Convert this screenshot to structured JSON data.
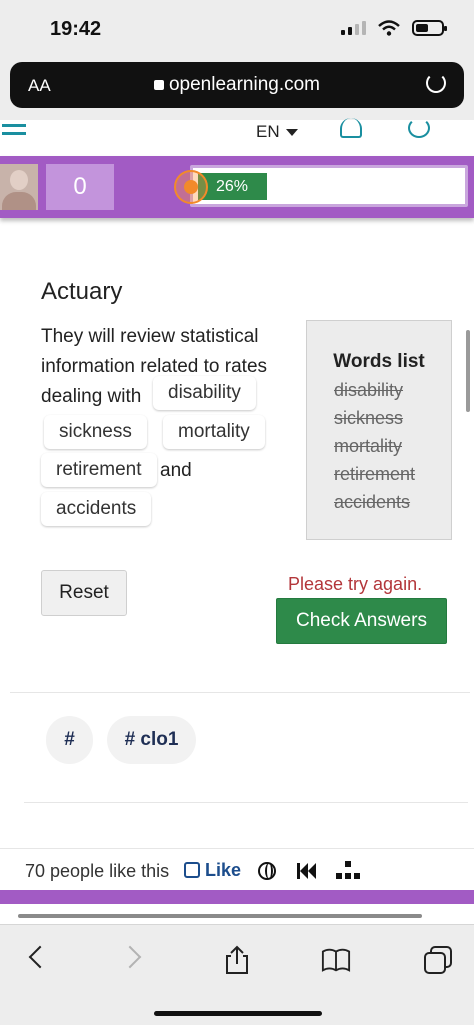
{
  "status_bar": {
    "time": "19:42"
  },
  "browser": {
    "text_size_label": "AA",
    "url": "openlearning.com"
  },
  "header": {
    "language": "EN"
  },
  "progress": {
    "points": "0",
    "percent_label": "26%",
    "percent": 26
  },
  "activity": {
    "title": "Actuary",
    "sentence_start": "They will review statistical information related to rates dealing with",
    "filled_words": [
      "disability",
      "sickness",
      "mortality",
      "retirement",
      "accidents"
    ],
    "connector": "and",
    "words_list_title": "Words list",
    "words_list": [
      "disability",
      "sickness",
      "mortality",
      "retirement",
      "accidents"
    ]
  },
  "actions": {
    "reset_label": "Reset",
    "feedback": "Please try again.",
    "check_label": "Check Answers"
  },
  "tags": [
    "#",
    "# clo1"
  ],
  "footer": {
    "likes_text": "70 people like this",
    "like_label": "Like"
  },
  "colors": {
    "purple": "#a25bc4",
    "green": "#2e8a4a",
    "error": "#b3363a",
    "teal": "#1a8fa0"
  },
  "icons": [
    "search-icon",
    "bell-icon",
    "globe-icon",
    "rewind-icon",
    "sitemap-icon",
    "share-icon",
    "book-icon",
    "tabs-icon"
  ]
}
